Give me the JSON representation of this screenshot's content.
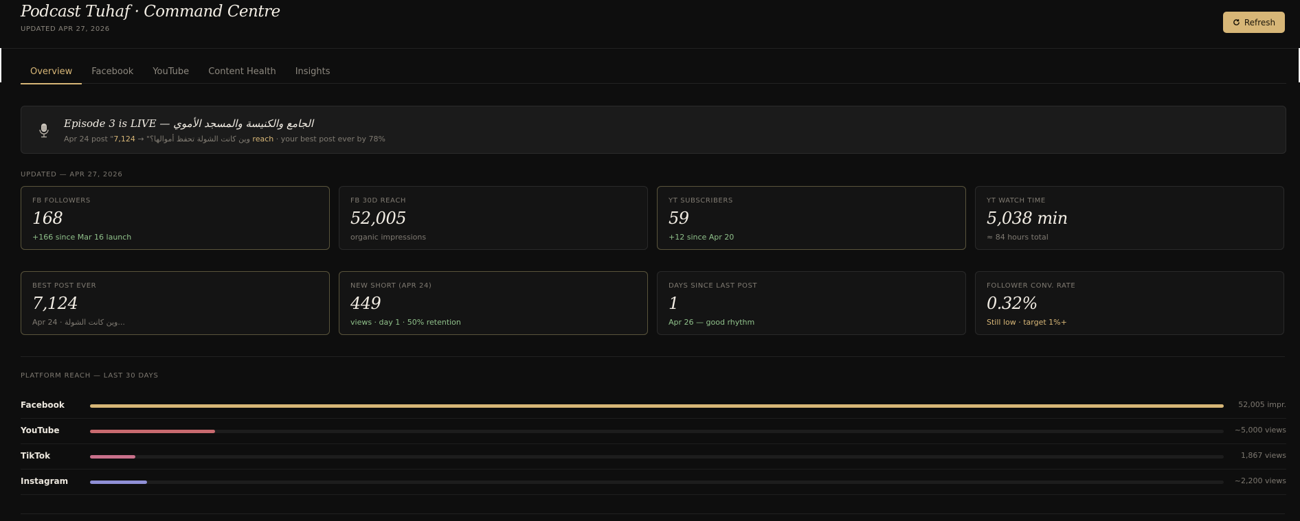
{
  "header": {
    "title": "Podcast Tuhaf · Command Centre",
    "updated": "UPDATED APR 27, 2026",
    "refresh_label": "Refresh"
  },
  "tabs": [
    {
      "label": "Overview",
      "active": true
    },
    {
      "label": "Facebook",
      "active": false
    },
    {
      "label": "YouTube",
      "active": false
    },
    {
      "label": "Content Health",
      "active": false
    },
    {
      "label": "Insights",
      "active": false
    }
  ],
  "banner": {
    "icon": "microphone-icon",
    "title": "Episode 3 is LIVE — الجامع والكنيسة والمسجد الأموي",
    "sub_prefix": "Apr 24 post \"وين كانت الشولة تحفظ أموالها؟\" → ",
    "sub_number": "7,124",
    "sub_reach": " reach",
    "sub_suffix": " · your best post ever by 78%"
  },
  "stats_label": "UPDATED — APR 27, 2026",
  "stats": [
    {
      "label": "FB FOLLOWERS",
      "value": "168",
      "note": "+166 since Mar 16 launch",
      "note_color": "#8fc08a",
      "highlight": true
    },
    {
      "label": "FB 30D REACH",
      "value": "52,005",
      "note": "organic impressions",
      "note_color": "#7f7a72",
      "highlight": false
    },
    {
      "label": "YT SUBSCRIBERS",
      "value": "59",
      "note": "+12 since Apr 20",
      "note_color": "#8fc08a",
      "highlight": true
    },
    {
      "label": "YT WATCH TIME",
      "value": "5,038 min",
      "note": "≈ 84 hours total",
      "note_color": "#7f7a72",
      "highlight": false
    },
    {
      "label": "BEST POST EVER",
      "value": "7,124",
      "note": "Apr 24 · وين كانت الشولة...",
      "note_color": "#7f7a72",
      "highlight": true
    },
    {
      "label": "NEW SHORT (APR 24)",
      "value": "449",
      "note": "views · day 1 · 50% retention",
      "note_color": "#8fc08a",
      "highlight": true
    },
    {
      "label": "DAYS SINCE LAST POST",
      "value": "1",
      "note": "Apr 26 — good rhythm",
      "note_color": "#8fc08a",
      "highlight": false
    },
    {
      "label": "FOLLOWER CONV. RATE",
      "value": "0.32%",
      "note": "Still low · target 1%+",
      "note_color": "#d7b677",
      "highlight": false
    }
  ],
  "reach_label": "PLATFORM REACH — LAST 30 DAYS",
  "reach": [
    {
      "name": "Facebook",
      "value": "52,005 impr.",
      "fraction": 1.0,
      "color": "#d7b677"
    },
    {
      "name": "YouTube",
      "value": "~5,000 views",
      "fraction": 0.11,
      "color": "#c96a6f"
    },
    {
      "name": "TikTok",
      "value": "1,867 views",
      "fraction": 0.04,
      "color": "#c9708b"
    },
    {
      "name": "Instagram",
      "value": "~2,200 views",
      "fraction": 0.05,
      "color": "#8f8fd6"
    }
  ]
}
